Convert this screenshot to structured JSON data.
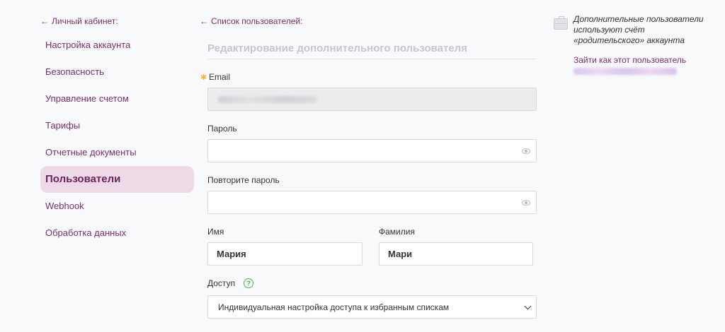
{
  "sidebar": {
    "back_label": "Личный кабинет:",
    "items": [
      {
        "label": "Настройка аккаунта"
      },
      {
        "label": "Безопасность"
      },
      {
        "label": "Управление счетом"
      },
      {
        "label": "Тарифы"
      },
      {
        "label": "Отчетные документы"
      },
      {
        "label": "Пользователи",
        "active": true
      },
      {
        "label": "Webhook"
      },
      {
        "label": "Обработка данных"
      }
    ]
  },
  "main": {
    "back_label": "Список пользователей:",
    "title": "Редактирование дополнительного пользователя",
    "email": {
      "label": "Email",
      "value": ""
    },
    "password": {
      "label": "Пароль",
      "value": ""
    },
    "password_repeat": {
      "label": "Повторите пароль",
      "value": ""
    },
    "first_name": {
      "label": "Имя",
      "value": "Мария"
    },
    "last_name": {
      "label": "Фамилия",
      "value": "Мари"
    },
    "access": {
      "label": "Доступ",
      "help_glyph": "?",
      "selected": "Индивидуальная настройка доступа к избранным спискам"
    }
  },
  "info": {
    "text": "Дополнительные пользователи используют счёт «родительского» аккаунта",
    "login_as_link": "Зайти как этот пользователь"
  },
  "colors": {
    "accent": "#7a2d6a",
    "active_bg": "#eed9e6",
    "help_green": "#4caf50",
    "required_star": "#f2b72a"
  },
  "icons": {
    "back": "arrow-left-icon",
    "eye": "eye-icon",
    "help": "question-circle-icon",
    "dropdown": "chevron-down-icon",
    "info": "briefcase-icon"
  }
}
